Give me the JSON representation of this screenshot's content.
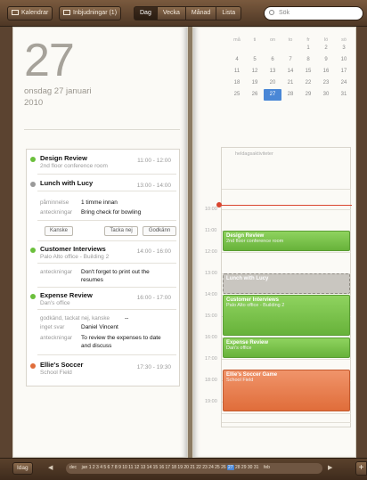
{
  "toolbar": {
    "calendars_label": "Kalendrar",
    "invitations_label": "Inbjudningar (1)",
    "views": [
      "Dag",
      "Vecka",
      "Månad",
      "Lista"
    ],
    "active_view": "Dag",
    "search_placeholder": "Sök"
  },
  "day": {
    "big_number": "27",
    "date_text": "onsdag 27 januari",
    "year": "2010"
  },
  "events": [
    {
      "title": "Design Review",
      "location": "2nd floor conference room",
      "time": "11:00 - 12:00",
      "color": "#6bbf3c"
    },
    {
      "title": "Lunch with Lucy",
      "time": "13:00 - 14:00",
      "color": "#9a9a9a",
      "reminder_label": "påminnelse",
      "reminder_value": "1 timme innan",
      "notes_label": "anteckningar",
      "notes_value": "Bring check for bowling",
      "buttons": [
        "Kanske",
        "Tacka nej",
        "Godkänn"
      ]
    },
    {
      "title": "Customer Interviews",
      "location": "Palo Alto office - Building 2",
      "time": "14:00 - 16:00",
      "color": "#6bbf3c",
      "notes_label": "anteckningar",
      "notes_line1": "Don't forget to print out the",
      "notes_line2": "resumes"
    },
    {
      "title": "Expense Review",
      "location": "Dan's office",
      "time": "16:00 - 17:00",
      "color": "#6bbf3c",
      "accepted_label": "godkänd, tackat nej, kanske",
      "accepted_value": "--",
      "no_reply_label": "inget svar",
      "no_reply_value": "Daniel Vincent",
      "notes_label": "anteckningar",
      "notes_line1": "To review the expenses to date",
      "notes_line2": "and discuss"
    },
    {
      "title": "Ellie's Soccer",
      "location": "School Field",
      "time": "17:30 - 19:30",
      "color": "#e06d3a"
    }
  ],
  "mini_calendar": {
    "weekdays": [
      "må",
      "ti",
      "on",
      "to",
      "fr",
      "lö",
      "sö"
    ],
    "weeks": [
      [
        "",
        "",
        "",
        "",
        "1",
        "2",
        "3"
      ],
      [
        "4",
        "5",
        "6",
        "7",
        "8",
        "9",
        "10"
      ],
      [
        "11",
        "12",
        "13",
        "14",
        "15",
        "16",
        "17"
      ],
      [
        "18",
        "19",
        "20",
        "21",
        "22",
        "23",
        "24"
      ],
      [
        "25",
        "26",
        "27",
        "28",
        "29",
        "30",
        "31"
      ]
    ],
    "selected": "27"
  },
  "day_view": {
    "all_day_label": "heldagsaktiviteter",
    "hours": [
      "10:00",
      "11:00",
      "12:00",
      "13:00",
      "14:00",
      "15:00",
      "16:00",
      "17:00",
      "18:00",
      "19:00"
    ],
    "blocks": [
      {
        "title": "Design Review",
        "sub": "2nd floor conference room"
      },
      {
        "title": "Lunch with Lucy",
        "sub": ""
      },
      {
        "title": "Customer Interviews",
        "sub": "Palo Alto office - Building 2"
      },
      {
        "title": "Expense Review",
        "sub": "Dan's office"
      },
      {
        "title": "Ellie's Soccer Game",
        "sub": "School Field"
      }
    ]
  },
  "bottom": {
    "today_label": "Idag",
    "prev_month": "dec",
    "month": "jan",
    "days": "1 2 3 4 5 6 7 8 9 10 11 12 13 14 15 16 17 18 19 20 21 22 23 24 25 26",
    "current_day": "27",
    "days_after": "28 29 30 31",
    "next_month": "feb",
    "add_label": "+"
  }
}
